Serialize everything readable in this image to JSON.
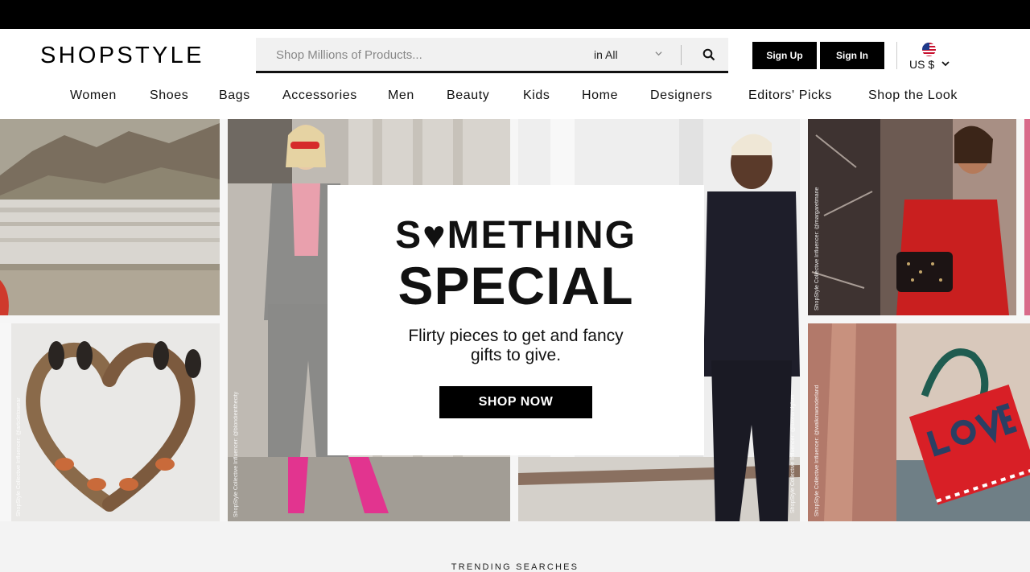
{
  "header": {
    "logo": "SHOPSTYLE",
    "search": {
      "placeholder": "Shop Millions of Products...",
      "scope": "in All"
    },
    "signup_label": "Sign Up",
    "signin_label": "Sign In",
    "locale": "US $"
  },
  "nav": {
    "items": [
      "Women",
      "Shoes",
      "Bags",
      "Accessories",
      "Men",
      "Beauty",
      "Kids",
      "Home",
      "Designers",
      "Editors' Picks",
      "Shop the Look"
    ]
  },
  "hero": {
    "headline_1": "S♥METHING",
    "headline_2": "SPECIAL",
    "subtext": "Flirty pieces to get and fancy gifts to give.",
    "cta": "SHOP NOW",
    "credits": [
      "ShopStyle Collective Influencer: @articletowear",
      "ShopStyle Collective Influencer: @blondieinthecity",
      "ShopStyle Collective Influencer: @luxeandglam",
      "ShopStyle Collective Influencer: @margaretmarie",
      "ShopStyle Collective Influencer: @walkinwonderland"
    ]
  },
  "trending": {
    "title": "TRENDING SEARCHES"
  },
  "colors": {
    "accent": "#000000",
    "topbar": "#000000",
    "search_bg": "#f1f1f1",
    "page_bg": "#f3f3f3"
  },
  "icons": [
    "search-icon",
    "chevron-down-icon",
    "us-flag-icon",
    "heart-icon"
  ]
}
